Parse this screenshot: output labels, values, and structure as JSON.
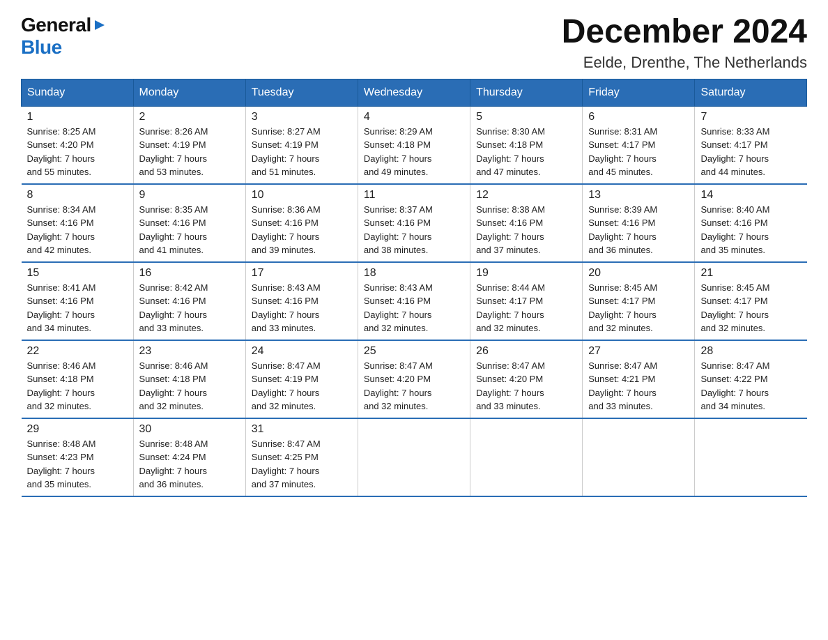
{
  "logo": {
    "general": "General",
    "arrow": "▶",
    "blue": "Blue"
  },
  "title": "December 2024",
  "subtitle": "Eelde, Drenthe, The Netherlands",
  "days_header": [
    "Sunday",
    "Monday",
    "Tuesday",
    "Wednesday",
    "Thursday",
    "Friday",
    "Saturday"
  ],
  "weeks": [
    [
      {
        "num": "1",
        "info": "Sunrise: 8:25 AM\nSunset: 4:20 PM\nDaylight: 7 hours\nand 55 minutes."
      },
      {
        "num": "2",
        "info": "Sunrise: 8:26 AM\nSunset: 4:19 PM\nDaylight: 7 hours\nand 53 minutes."
      },
      {
        "num": "3",
        "info": "Sunrise: 8:27 AM\nSunset: 4:19 PM\nDaylight: 7 hours\nand 51 minutes."
      },
      {
        "num": "4",
        "info": "Sunrise: 8:29 AM\nSunset: 4:18 PM\nDaylight: 7 hours\nand 49 minutes."
      },
      {
        "num": "5",
        "info": "Sunrise: 8:30 AM\nSunset: 4:18 PM\nDaylight: 7 hours\nand 47 minutes."
      },
      {
        "num": "6",
        "info": "Sunrise: 8:31 AM\nSunset: 4:17 PM\nDaylight: 7 hours\nand 45 minutes."
      },
      {
        "num": "7",
        "info": "Sunrise: 8:33 AM\nSunset: 4:17 PM\nDaylight: 7 hours\nand 44 minutes."
      }
    ],
    [
      {
        "num": "8",
        "info": "Sunrise: 8:34 AM\nSunset: 4:16 PM\nDaylight: 7 hours\nand 42 minutes."
      },
      {
        "num": "9",
        "info": "Sunrise: 8:35 AM\nSunset: 4:16 PM\nDaylight: 7 hours\nand 41 minutes."
      },
      {
        "num": "10",
        "info": "Sunrise: 8:36 AM\nSunset: 4:16 PM\nDaylight: 7 hours\nand 39 minutes."
      },
      {
        "num": "11",
        "info": "Sunrise: 8:37 AM\nSunset: 4:16 PM\nDaylight: 7 hours\nand 38 minutes."
      },
      {
        "num": "12",
        "info": "Sunrise: 8:38 AM\nSunset: 4:16 PM\nDaylight: 7 hours\nand 37 minutes."
      },
      {
        "num": "13",
        "info": "Sunrise: 8:39 AM\nSunset: 4:16 PM\nDaylight: 7 hours\nand 36 minutes."
      },
      {
        "num": "14",
        "info": "Sunrise: 8:40 AM\nSunset: 4:16 PM\nDaylight: 7 hours\nand 35 minutes."
      }
    ],
    [
      {
        "num": "15",
        "info": "Sunrise: 8:41 AM\nSunset: 4:16 PM\nDaylight: 7 hours\nand 34 minutes."
      },
      {
        "num": "16",
        "info": "Sunrise: 8:42 AM\nSunset: 4:16 PM\nDaylight: 7 hours\nand 33 minutes."
      },
      {
        "num": "17",
        "info": "Sunrise: 8:43 AM\nSunset: 4:16 PM\nDaylight: 7 hours\nand 33 minutes."
      },
      {
        "num": "18",
        "info": "Sunrise: 8:43 AM\nSunset: 4:16 PM\nDaylight: 7 hours\nand 32 minutes."
      },
      {
        "num": "19",
        "info": "Sunrise: 8:44 AM\nSunset: 4:17 PM\nDaylight: 7 hours\nand 32 minutes."
      },
      {
        "num": "20",
        "info": "Sunrise: 8:45 AM\nSunset: 4:17 PM\nDaylight: 7 hours\nand 32 minutes."
      },
      {
        "num": "21",
        "info": "Sunrise: 8:45 AM\nSunset: 4:17 PM\nDaylight: 7 hours\nand 32 minutes."
      }
    ],
    [
      {
        "num": "22",
        "info": "Sunrise: 8:46 AM\nSunset: 4:18 PM\nDaylight: 7 hours\nand 32 minutes."
      },
      {
        "num": "23",
        "info": "Sunrise: 8:46 AM\nSunset: 4:18 PM\nDaylight: 7 hours\nand 32 minutes."
      },
      {
        "num": "24",
        "info": "Sunrise: 8:47 AM\nSunset: 4:19 PM\nDaylight: 7 hours\nand 32 minutes."
      },
      {
        "num": "25",
        "info": "Sunrise: 8:47 AM\nSunset: 4:20 PM\nDaylight: 7 hours\nand 32 minutes."
      },
      {
        "num": "26",
        "info": "Sunrise: 8:47 AM\nSunset: 4:20 PM\nDaylight: 7 hours\nand 33 minutes."
      },
      {
        "num": "27",
        "info": "Sunrise: 8:47 AM\nSunset: 4:21 PM\nDaylight: 7 hours\nand 33 minutes."
      },
      {
        "num": "28",
        "info": "Sunrise: 8:47 AM\nSunset: 4:22 PM\nDaylight: 7 hours\nand 34 minutes."
      }
    ],
    [
      {
        "num": "29",
        "info": "Sunrise: 8:48 AM\nSunset: 4:23 PM\nDaylight: 7 hours\nand 35 minutes."
      },
      {
        "num": "30",
        "info": "Sunrise: 8:48 AM\nSunset: 4:24 PM\nDaylight: 7 hours\nand 36 minutes."
      },
      {
        "num": "31",
        "info": "Sunrise: 8:47 AM\nSunset: 4:25 PM\nDaylight: 7 hours\nand 37 minutes."
      },
      {
        "num": "",
        "info": ""
      },
      {
        "num": "",
        "info": ""
      },
      {
        "num": "",
        "info": ""
      },
      {
        "num": "",
        "info": ""
      }
    ]
  ]
}
